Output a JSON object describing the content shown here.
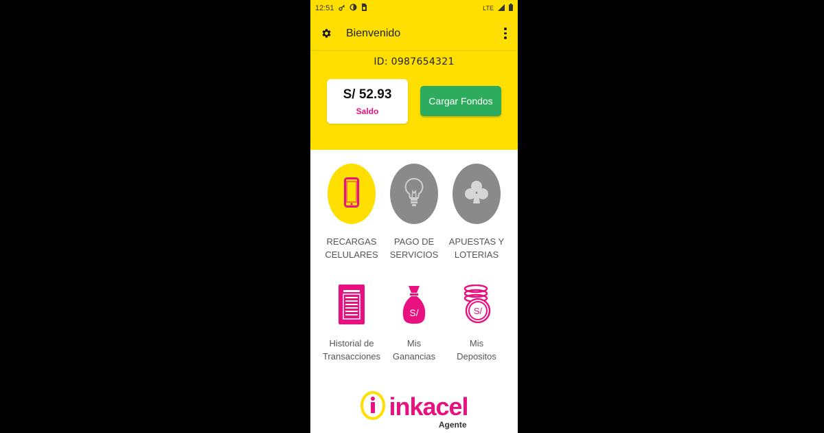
{
  "status_bar": {
    "time": "12:51",
    "network": "LTE",
    "icons": [
      "vpn-key-icon",
      "data-saver-icon",
      "sim-card-icon",
      "signal-icon",
      "battery-icon"
    ]
  },
  "app_bar": {
    "title": "Bienvenido",
    "left_icon": "gear-icon",
    "right_icon": "more-vert-icon"
  },
  "account": {
    "id_label": "ID:",
    "id_value": "0987654321",
    "balance": "S/ 52.93",
    "balance_label": "Saldo",
    "load_button": "Cargar Fondos"
  },
  "menu": {
    "recargas": {
      "label": "RECARGAS\nCELULARES",
      "icon": "smartphone-icon"
    },
    "servicios": {
      "label": "PAGO DE\nSERVICIOS",
      "icon": "lightbulb-icon"
    },
    "apuestas": {
      "label": "APUESTAS Y\nLOTERIAS",
      "icon": "club-icon"
    },
    "historial": {
      "label": "Historial de\nTransacciones",
      "icon": "receipt-icon"
    },
    "ganancias": {
      "label": "Mis\nGanancias",
      "icon": "money-bag-icon"
    },
    "depositos": {
      "label": "Mis\nDepositos",
      "icon": "coins-icon"
    }
  },
  "logo": {
    "word": "inkacel",
    "sub": "Agente"
  },
  "colors": {
    "brand_yellow": "#ffdf00",
    "brand_pink": "#e8117f",
    "button_green": "#2eac5e",
    "circle_gray": "#8a8a8a"
  }
}
